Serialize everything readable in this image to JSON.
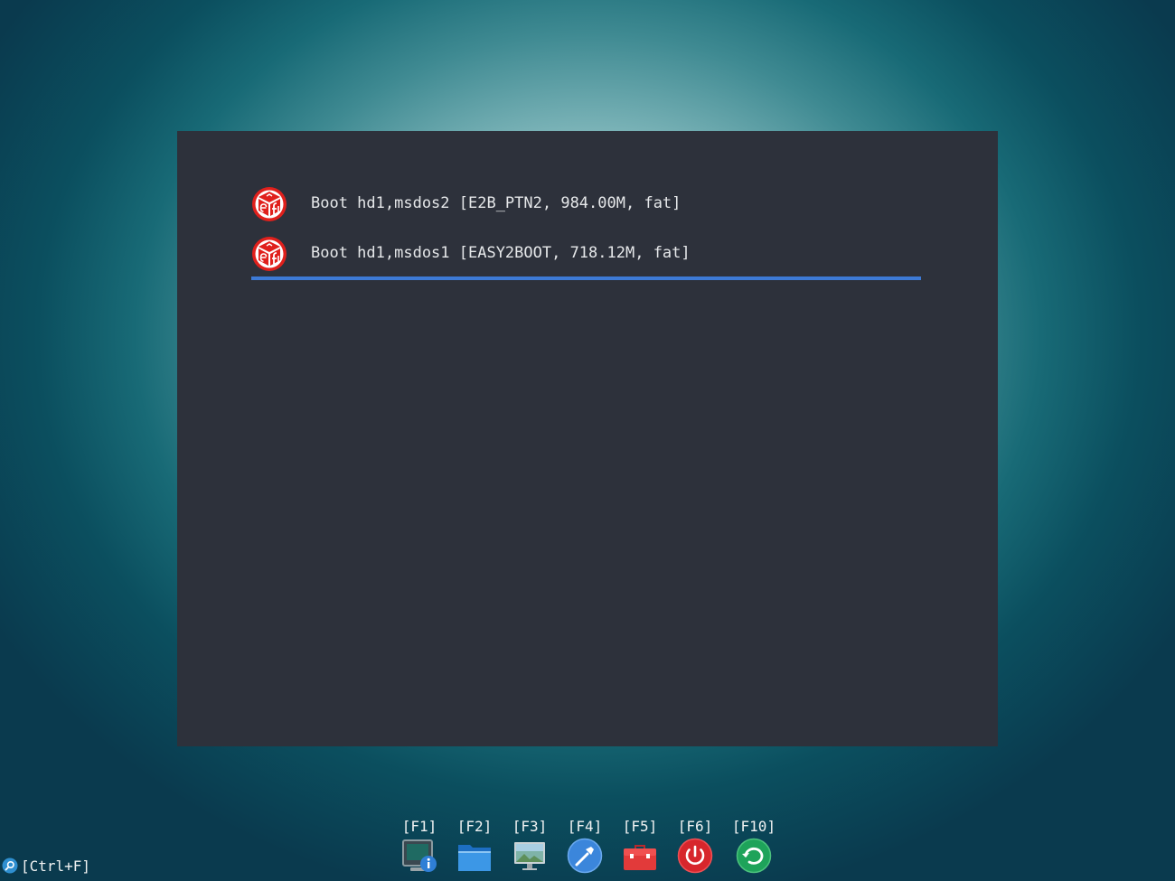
{
  "menu": {
    "entries": [
      {
        "label": "Boot hd1,msdos2 [E2B_PTN2, 984.00M, fat]",
        "icon": "uefi-icon",
        "selected": false
      },
      {
        "label": "Boot hd1,msdos1 [EASY2BOOT, 718.12M, fat]",
        "icon": "uefi-icon",
        "selected": true
      }
    ]
  },
  "hotkeys": [
    {
      "key": "[F1]",
      "icon": "system-info-icon"
    },
    {
      "key": "[F2]",
      "icon": "folder-icon"
    },
    {
      "key": "[F3]",
      "icon": "display-icon"
    },
    {
      "key": "[F4]",
      "icon": "settings-icon"
    },
    {
      "key": "[F5]",
      "icon": "toolbox-icon"
    },
    {
      "key": "[F6]",
      "icon": "power-icon"
    },
    {
      "key": "[F10]",
      "icon": "reboot-icon"
    }
  ],
  "search": {
    "hint": "[Ctrl+F]",
    "icon": "search-icon"
  },
  "colors": {
    "panel": "#2d313b",
    "selection_bar": "#3d7ad6",
    "uefi_red": "#e0201c",
    "text": "#e6e8ea"
  }
}
